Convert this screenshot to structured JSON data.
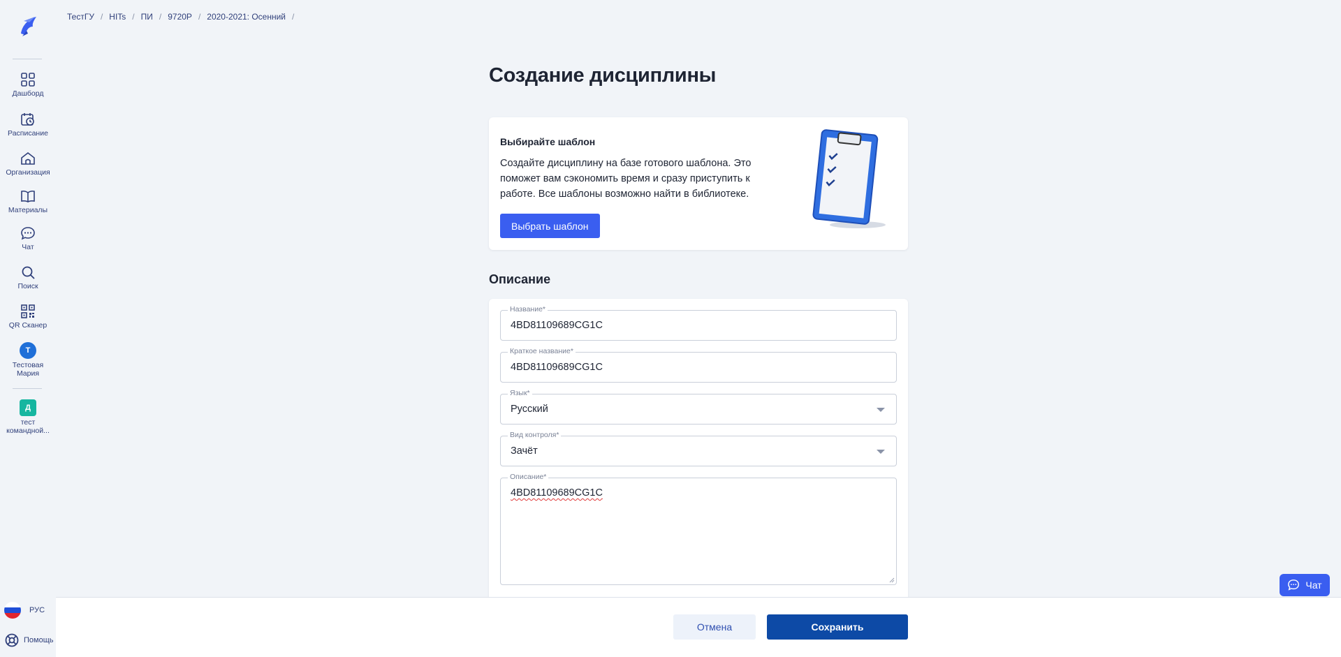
{
  "sidebar": {
    "items": [
      {
        "label": "Дашборд",
        "icon": "grid-icon"
      },
      {
        "label": "Расписание",
        "icon": "calendar-clock-icon"
      },
      {
        "label": "Организация",
        "icon": "building-icon"
      },
      {
        "label": "Материалы",
        "icon": "book-icon"
      },
      {
        "label": "Чат",
        "icon": "chat-icon"
      },
      {
        "label": "Поиск",
        "icon": "search-icon"
      },
      {
        "label": "QR Сканер",
        "icon": "qr-icon"
      }
    ],
    "user": {
      "initial": "Т",
      "name": "Тестовая Мария",
      "color": "#1f6fd8"
    },
    "team": {
      "initial": "Д",
      "name": "тест командной...",
      "color": "#16b6a0"
    },
    "language": "РУС",
    "help": "Помощь"
  },
  "breadcrumb": [
    "ТестГУ",
    "HITs",
    "ПИ",
    "9720Р",
    "2020-2021: Осенний"
  ],
  "breadcrumb_separator": "/",
  "page": {
    "title": "Создание дисциплины"
  },
  "template_card": {
    "title": "Выбирайте шаблон",
    "text": "Создайте дисциплину на базе готового шаблона. Это поможет вам сэкономить время и сразу приступить к работе. Все шаблоны возможно найти в библиотеке.",
    "button": "Выбрать шаблон"
  },
  "description_section": {
    "title": "Описание",
    "fields": {
      "name": {
        "label": "Название*",
        "value": "4BD81109689CG1C"
      },
      "short_name": {
        "label": "Краткое название*",
        "value": "4BD81109689CG1C"
      },
      "language": {
        "label": "Язык*",
        "value": "Русский"
      },
      "control_type": {
        "label": "Вид контроля*",
        "value": "Зачёт"
      },
      "description": {
        "label": "Описание*",
        "value": "4BD81109689CG1C"
      }
    }
  },
  "footer": {
    "cancel": "Отмена",
    "save": "Сохранить"
  },
  "chat_widget": {
    "label": "Чат"
  },
  "colors": {
    "accent": "#3a5ef0",
    "save": "#0d4aa6",
    "background": "#f1f4f8"
  }
}
